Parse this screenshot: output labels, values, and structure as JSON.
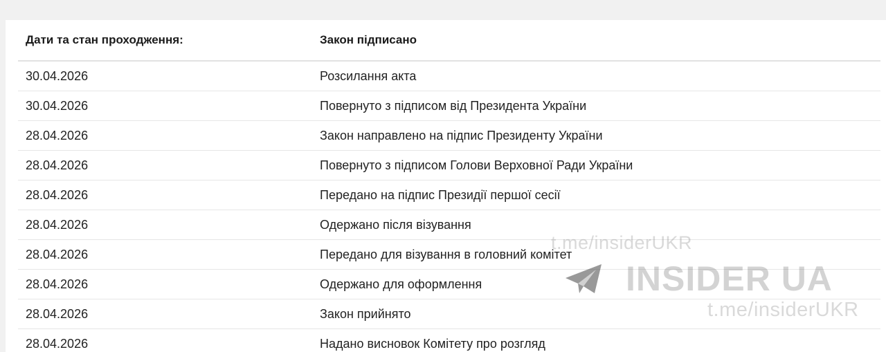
{
  "table": {
    "header": {
      "date_col": "Дати та стан проходження:",
      "status_col": "Закон підписано"
    },
    "rows": [
      {
        "date": "30.04.2026",
        "status": "Розсилання акта"
      },
      {
        "date": "30.04.2026",
        "status": "Повернуто з підписом від Президента України"
      },
      {
        "date": "28.04.2026",
        "status": "Закон направлено на підпис Президенту України"
      },
      {
        "date": "28.04.2026",
        "status": "Повернуто з підписом Голови Верховної Ради України"
      },
      {
        "date": "28.04.2026",
        "status": "Передано на підпис Президії першої сесії"
      },
      {
        "date": "28.04.2026",
        "status": "Одержано після візування"
      },
      {
        "date": "28.04.2026",
        "status": "Передано для візування в головний комітет"
      },
      {
        "date": "28.04.2026",
        "status": "Одержано для оформлення"
      },
      {
        "date": "28.04.2026",
        "status": "Закон прийнято"
      },
      {
        "date": "28.04.2026",
        "status": "Надано висновок Комітету про розгляд"
      }
    ]
  },
  "watermark": {
    "handle_top": "t.me/insiderUKR",
    "brand": "INSIDER UA",
    "handle_bottom": "t.me/insiderUKR",
    "logo_icon": "telegram-paper-plane-icon"
  }
}
